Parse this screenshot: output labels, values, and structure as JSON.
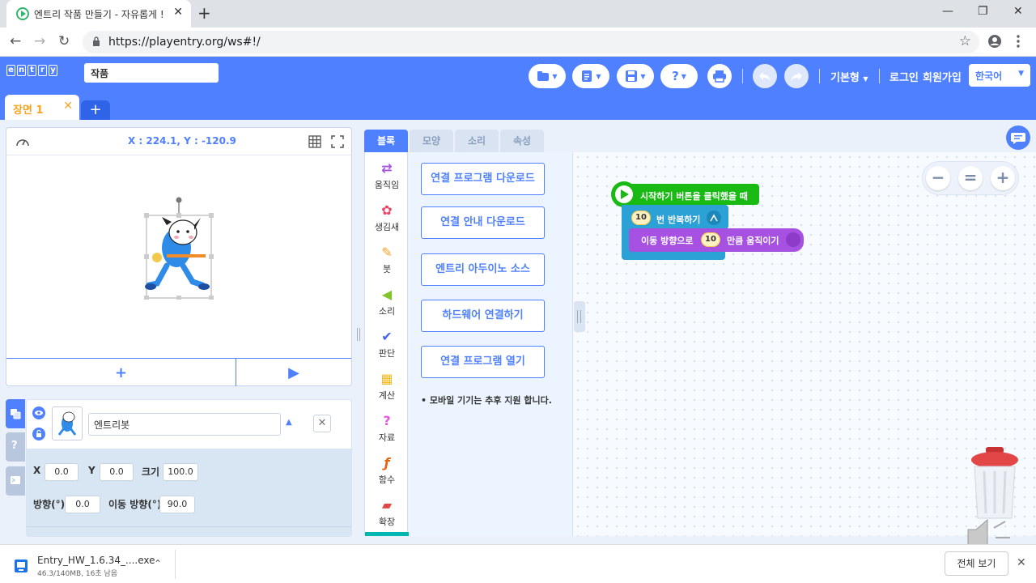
{
  "browser": {
    "tab_title": "엔트리 작품 만들기 - 자유롭게 !",
    "tab_close": "✕",
    "new_tab": "+",
    "url": "https://playentry.org/ws#!/",
    "window_controls": [
      "—",
      "❐",
      "✕"
    ]
  },
  "header": {
    "logo_letters": [
      "e",
      "n",
      "t",
      "r",
      "y"
    ],
    "project_name": "작품",
    "mode_label": "기본형",
    "login_label": "로그인",
    "signup_label": "회원가입",
    "language": "한국어",
    "help_glyph": "?"
  },
  "scene": {
    "tab_label": "장면 1",
    "close_glyph": "✕",
    "add_glyph": "+"
  },
  "stage": {
    "coords": "X : 224.1, Y : -120.9",
    "add_glyph": "+",
    "run_glyph": "▶"
  },
  "object": {
    "name": "엔트리봇",
    "x_label": "X",
    "x_value": "0.0",
    "y_label": "Y",
    "y_value": "0.0",
    "size_label": "크기",
    "size_value": "100.0",
    "direction_label": "방향(°)",
    "direction_value": "0.0",
    "move_direction_label": "이동 방향(°)",
    "move_direction_value": "90.0",
    "side_help": "?"
  },
  "block_tabs": [
    "블록",
    "모양",
    "소리",
    "속성"
  ],
  "categories": [
    {
      "label": "움직임",
      "icon": "⇄",
      "color": "#a751e3"
    },
    {
      "label": "생김새",
      "icon": "✿",
      "color": "#ec4466"
    },
    {
      "label": "붓",
      "icon": "✎",
      "color": "#ff9e20"
    },
    {
      "label": "소리",
      "icon": "◀",
      "color": "#83c42c"
    },
    {
      "label": "판단",
      "icon": "✔",
      "color": "#4562f5"
    },
    {
      "label": "계산",
      "icon": "▦",
      "color": "#f3b81b"
    },
    {
      "label": "자료",
      "icon": "?",
      "color": "#e457dc"
    },
    {
      "label": "함수",
      "icon": "ƒ",
      "color": "#e6620c"
    },
    {
      "label": "확장",
      "icon": "▰",
      "color": "#e24646"
    }
  ],
  "hardware_buttons": [
    "연결 프로그램 다운로드",
    "연결 안내 다운로드",
    "엔트리 아두이노 소스",
    "하드웨어 연결하기",
    "연결 프로그램 열기"
  ],
  "hardware_note": "• 모바일 기기는 추후 지원 합니다.",
  "code_blocks": {
    "start": "시작하기 버튼을 클릭했을 때",
    "repeat_count": "10",
    "repeat_text": "번 반복하기",
    "move_prefix": "이동 방향으로",
    "move_count": "10",
    "move_suffix": "만큼 움직이기"
  },
  "zoom": [
    "−",
    "=",
    "+"
  ],
  "download": {
    "file_name": "Entry_HW_1.6.34_....exe",
    "status": "46.3/140MB, 16초 남음",
    "show_all": "전체 보기"
  },
  "colors": {
    "brand_blue": "#4f80ff",
    "flow_blue": "#2ca1d6",
    "start_green": "#19ba13",
    "motion_purple": "#a751e3",
    "scene_orange": "#f5a623"
  }
}
